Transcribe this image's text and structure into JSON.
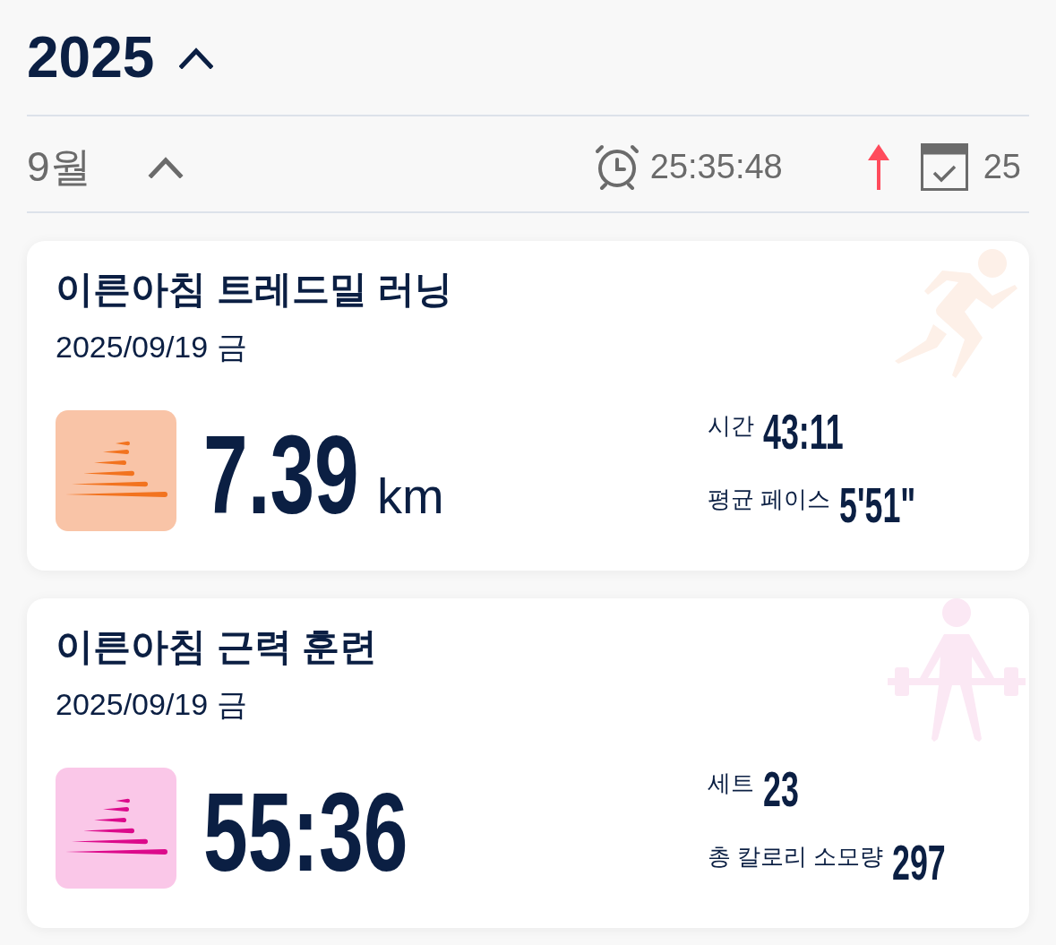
{
  "year": {
    "label": "2025",
    "expanded": true
  },
  "month": {
    "label": "9월",
    "expanded": true,
    "total_time": "25:35:48",
    "increased": true,
    "count": "25"
  },
  "activities": [
    {
      "kind": "running",
      "title": "이른아침 트레드밀 러닝",
      "date": "2025/09/19 금",
      "value": "7.39",
      "unit": "km",
      "stats": [
        {
          "label": "시간",
          "value": "43:11"
        },
        {
          "label": "평균 페이스",
          "value": "5'51\""
        }
      ]
    },
    {
      "kind": "strength",
      "title": "이른아침 근력 훈련",
      "date": "2025/09/19 금",
      "value": "55:36",
      "stats": [
        {
          "label": "세트",
          "value": "23"
        },
        {
          "label": "총 칼로리 소모량",
          "value": "297"
        }
      ]
    }
  ]
}
